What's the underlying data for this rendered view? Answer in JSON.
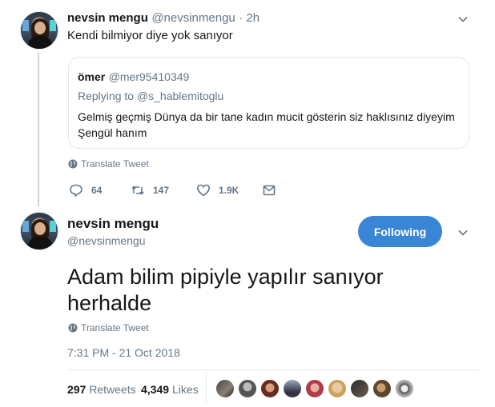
{
  "reply": {
    "name": "nevsin mengu",
    "handle": "@nevsinmengu",
    "time": "· 2h",
    "text": "Kendi bilmiyor diye yok sanıyor",
    "translate": "Translate Tweet",
    "replies": "64",
    "retweets": "147",
    "likes": "1.9K"
  },
  "quote": {
    "name": "ömer",
    "handle": "@mer95410349",
    "replying_prefix": "Replying to ",
    "replying_to": "@s_hablemitoglu",
    "line1": "Gelmiş geçmiş Dünya da bir tane kadın  mucit gösterin siz haklısınız diyeyim",
    "line2": "Şengül hanım"
  },
  "main": {
    "name": "nevsin mengu",
    "handle": "@nevsinmengu",
    "follow_label": "Following",
    "text": "Adam bilim pipiyle yapılır sanıyor herhalde",
    "translate": "Translate Tweet",
    "timestamp": "7:31 PM - 21 Oct 2018",
    "retweet_count": "297",
    "retweet_label": "Retweets",
    "like_count": "4,349",
    "like_label": "Likes"
  },
  "colors": {
    "accent": "#3a86d6",
    "gray": "#657786",
    "text": "#14171a",
    "border": "#e1e8ed"
  },
  "icons": [
    "chevron-down-icon",
    "globe-icon",
    "reply-icon",
    "retweet-icon",
    "heart-icon",
    "dm-icon"
  ],
  "liker_avatars": 9
}
